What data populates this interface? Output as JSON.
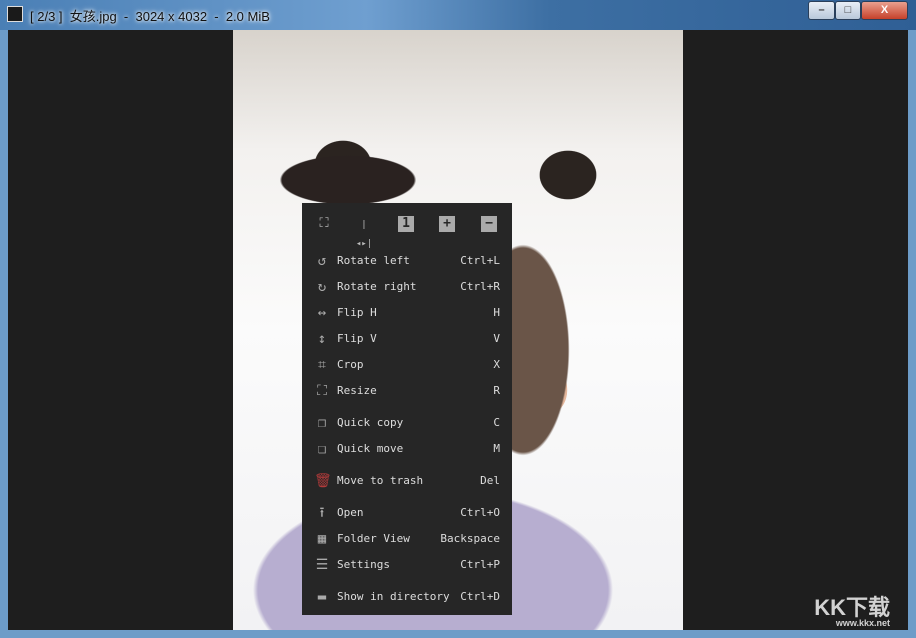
{
  "window": {
    "app_icon": "qimgv",
    "title": "[ 2/3 ]  女孩.jpg  -  3024 x 4032  -  2.0 MiB",
    "minimize": "–",
    "maximize": "□",
    "close": "X"
  },
  "watermark": {
    "text": "KK下载",
    "url": "www.kkx.net"
  },
  "menu": {
    "toolbar": [
      {
        "icon": "fit-window-icon",
        "glyph": "⛶"
      },
      {
        "icon": "fit-width-icon",
        "glyph": "|◂▸|"
      },
      {
        "icon": "original-size-icon",
        "glyph": "1"
      },
      {
        "icon": "zoom-in-icon",
        "glyph": "+"
      },
      {
        "icon": "zoom-out-icon",
        "glyph": "−"
      }
    ],
    "items": [
      {
        "icon": "rotate-left-icon",
        "glyph": "↺",
        "label": "Rotate left",
        "shortcut": "Ctrl+L"
      },
      {
        "icon": "rotate-right-icon",
        "glyph": "↻",
        "label": "Rotate right",
        "shortcut": "Ctrl+R"
      },
      {
        "icon": "flip-h-icon",
        "glyph": "↔",
        "label": "Flip H",
        "shortcut": "H"
      },
      {
        "icon": "flip-v-icon",
        "glyph": "↕",
        "label": "Flip V",
        "shortcut": "V"
      },
      {
        "icon": "crop-icon",
        "glyph": "⌗",
        "label": "Crop",
        "shortcut": "X"
      },
      {
        "icon": "resize-icon",
        "glyph": "⛶",
        "label": "Resize",
        "shortcut": "R"
      },
      {
        "icon": "quick-copy-icon",
        "glyph": "❐",
        "label": "Quick copy",
        "shortcut": "C"
      },
      {
        "icon": "quick-move-icon",
        "glyph": "❏",
        "label": "Quick move",
        "shortcut": "M"
      },
      {
        "icon": "trash-icon",
        "glyph": "🗑",
        "label": "Move to trash",
        "shortcut": "Del"
      },
      {
        "icon": "open-icon",
        "glyph": "⭱",
        "label": "Open",
        "shortcut": "Ctrl+O"
      },
      {
        "icon": "folder-view-icon",
        "glyph": "▦",
        "label": "Folder View",
        "shortcut": "Backspace"
      },
      {
        "icon": "settings-icon",
        "glyph": "☰",
        "label": "Settings",
        "shortcut": "Ctrl+P"
      },
      {
        "icon": "folder-icon",
        "glyph": "▬",
        "label": "Show in directory",
        "shortcut": "Ctrl+D"
      }
    ],
    "trash_color": "#b03a3a"
  }
}
